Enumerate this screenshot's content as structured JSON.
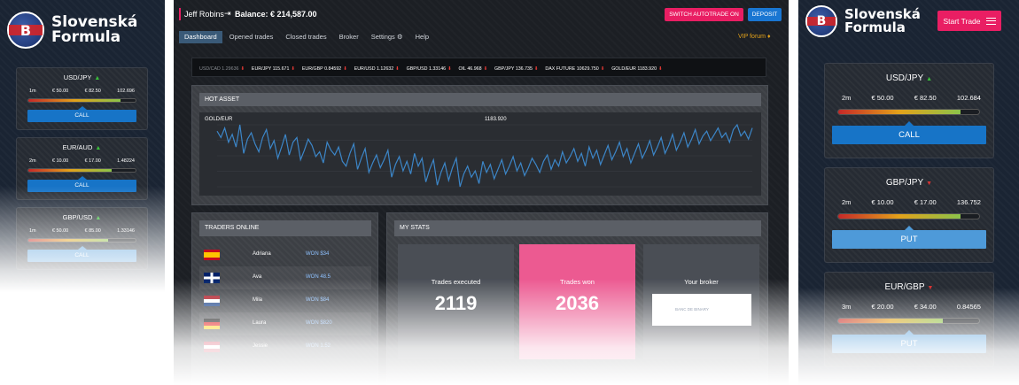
{
  "brand": {
    "line1": "Slovenská",
    "line2": "Formula",
    "logo_letter": "B"
  },
  "left_panel": {
    "assets": [
      {
        "pair": "USD/JPY",
        "trend": "up",
        "time": "1m",
        "low": "€ 50.00",
        "high": "€ 82.50",
        "rate": "102.696",
        "level": 0.86,
        "action": "CALL",
        "action_color": "#1774c7"
      },
      {
        "pair": "EUR/AUD",
        "trend": "up",
        "time": "2m",
        "low": "€ 10.00",
        "high": "€ 17.00",
        "rate": "1.48224",
        "level": 0.78,
        "action": "CALL",
        "action_color": "#1774c7"
      },
      {
        "pair": "GBP/USD",
        "trend": "up",
        "time": "1m",
        "low": "€ 50.00",
        "high": "€ 85.00",
        "rate": "1.33146",
        "level": 0.74,
        "action": "CALL",
        "action_color": "#4e9ad9"
      }
    ]
  },
  "desktop": {
    "user": {
      "name": "Jeff Robins",
      "balance": "Balance: € 214,587.00"
    },
    "buttons": {
      "autotrade": "SWITCH AUTOTRADE ON",
      "deposit": "DEPOSIT"
    },
    "nav": [
      "Dashboard",
      "Opened trades",
      "Closed trades",
      "Broker",
      "Settings",
      "Help"
    ],
    "vip": "VIP forum",
    "ticker": [
      {
        "text": "USD/CAD 1.29636",
        "dim": true
      },
      {
        "text": "EUR/JPY 115.671",
        "dim": false
      },
      {
        "text": "EUR/GBP 0.84592",
        "dim": false
      },
      {
        "text": "EUR/USD 1.12632",
        "dim": false
      },
      {
        "text": "GBP/USD 1.33146",
        "dim": false
      },
      {
        "text": "OIL 46.968",
        "dim": false
      },
      {
        "text": "GBP/JPY 136.735",
        "dim": false
      },
      {
        "text": "DAX FUTURE 10629.750",
        "dim": false
      },
      {
        "text": "GOLD/EUR 1183.920",
        "dim": false
      }
    ],
    "hot_asset": {
      "title": "HOT ASSET",
      "asset": "GOLD/EUR",
      "price": "1183.920"
    },
    "traders": {
      "title": "TRADERS ONLINE",
      "rows": [
        {
          "flag": "es",
          "name": "Adriana",
          "won": "WON $34"
        },
        {
          "flag": "gb",
          "name": "Ava",
          "won": "WON 48.5"
        },
        {
          "flag": "nl",
          "name": "Mila",
          "won": "WON $84"
        },
        {
          "flag": "de",
          "name": "Laura",
          "won": "WON $820"
        },
        {
          "flag": "gb2",
          "name": "Jessie",
          "won": "WON 1.52"
        }
      ]
    },
    "stats": {
      "title": "MY STATS",
      "executed_label": "Trades executed",
      "executed_value": "2119",
      "won_label": "Trades won",
      "won_value": "2036",
      "broker_label": "Your broker",
      "broker_name": "BANC DE BINARY"
    }
  },
  "right_panel": {
    "start_trade": "Start Trade",
    "assets": [
      {
        "pair": "USD/JPY",
        "trend": "up",
        "time": "2m",
        "low": "€ 50.00",
        "high": "€ 82.50",
        "rate": "102.684",
        "level": 0.87,
        "action": "CALL"
      },
      {
        "pair": "GBP/JPY",
        "trend": "down",
        "time": "2m",
        "low": "€ 10.00",
        "high": "€ 17.00",
        "rate": "136.752",
        "level": 0.87,
        "action": "PUT"
      },
      {
        "pair": "EUR/GBP",
        "trend": "down",
        "time": "3m",
        "low": "€ 20.00",
        "high": "€ 34.00",
        "rate": "0.84565",
        "level": 0.74,
        "action": "PUT"
      }
    ]
  },
  "chart_data": {
    "type": "line",
    "title": "GOLD/EUR",
    "last_value": "1183.920",
    "series": [
      {
        "values": [
          62,
          58,
          64,
          55,
          60,
          52,
          66,
          48,
          57,
          61,
          54,
          49,
          58,
          63,
          51,
          56,
          45,
          52,
          60,
          47,
          55,
          58,
          44,
          50,
          57,
          53,
          46,
          49,
          42,
          55,
          50,
          47,
          52,
          43,
          40,
          48,
          54,
          38,
          45,
          51,
          36,
          42,
          47,
          39,
          44,
          50,
          33,
          41,
          46,
          37,
          43,
          35,
          48,
          40,
          45,
          30,
          38,
          44,
          28,
          36,
          42,
          31,
          39,
          45,
          27,
          35,
          40,
          33,
          37,
          29,
          43,
          36,
          41,
          32,
          38,
          44,
          35,
          40,
          46,
          37,
          42,
          34,
          39,
          45,
          41,
          36,
          43,
          47,
          38,
          44,
          40,
          49,
          42,
          46,
          51,
          43,
          48,
          40,
          52,
          45,
          50,
          41,
          47,
          53,
          44,
          49,
          55,
          46,
          51,
          42,
          48,
          54,
          45,
          50,
          56,
          47,
          52,
          58,
          48,
          53,
          60,
          50,
          55,
          61,
          52,
          57,
          63,
          54,
          59,
          62,
          56,
          60,
          64,
          58,
          61,
          55,
          63,
          66,
          59,
          62,
          57,
          64
        ]
      }
    ]
  },
  "colors": {
    "pink": "#e91e63",
    "blue": "#1976d2",
    "gold": "#e3a21a",
    "line": "#3c86c8"
  }
}
